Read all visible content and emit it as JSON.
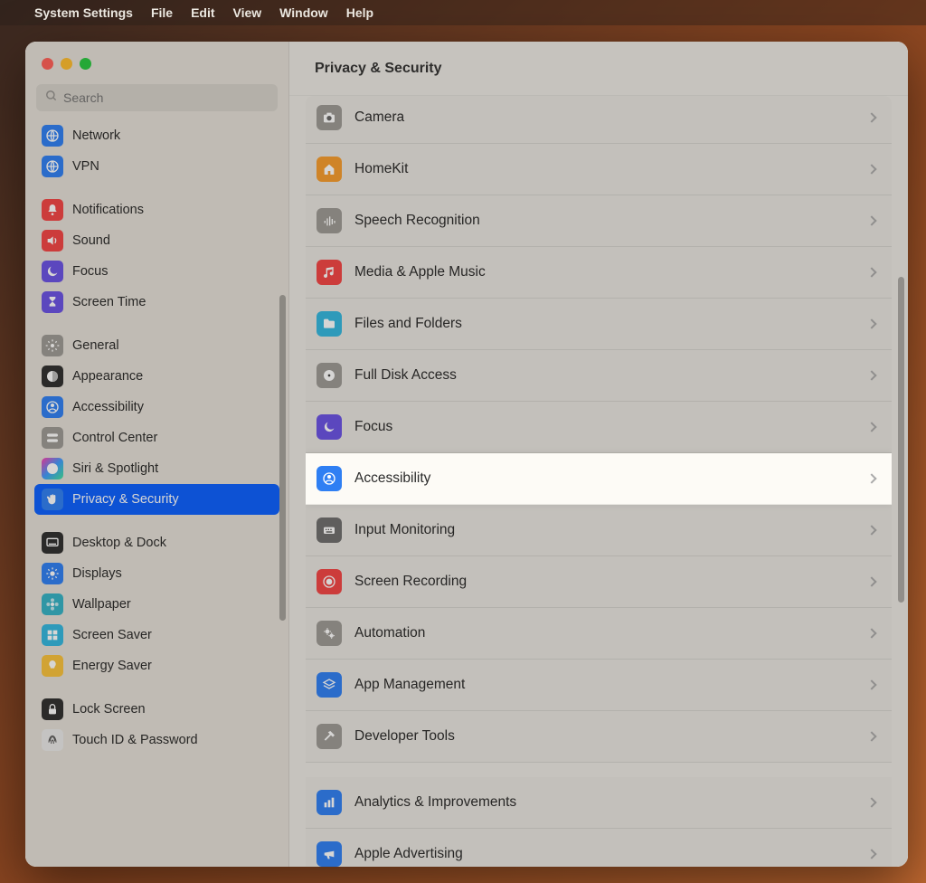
{
  "menubar": {
    "apple": "",
    "app": "System Settings",
    "items": [
      "File",
      "Edit",
      "View",
      "Window",
      "Help"
    ]
  },
  "search_placeholder": "Search",
  "page_title": "Privacy & Security",
  "sidebar_groups": [
    {
      "items": [
        {
          "label": "Network",
          "icon": "globe",
          "bg": "bg-blue"
        },
        {
          "label": "VPN",
          "icon": "globe",
          "bg": "bg-blue"
        }
      ]
    },
    {
      "items": [
        {
          "label": "Notifications",
          "icon": "bell",
          "bg": "bg-red"
        },
        {
          "label": "Sound",
          "icon": "speaker",
          "bg": "bg-red"
        },
        {
          "label": "Focus",
          "icon": "moon",
          "bg": "bg-purple"
        },
        {
          "label": "Screen Time",
          "icon": "hourglass",
          "bg": "bg-purple"
        }
      ]
    },
    {
      "items": [
        {
          "label": "General",
          "icon": "gear",
          "bg": "bg-gray"
        },
        {
          "label": "Appearance",
          "icon": "contrast",
          "bg": "bg-black"
        },
        {
          "label": "Accessibility",
          "icon": "person",
          "bg": "bg-blue"
        },
        {
          "label": "Control Center",
          "icon": "switches",
          "bg": "bg-gray"
        },
        {
          "label": "Siri & Spotlight",
          "icon": "siri",
          "bg": "bg-siri"
        },
        {
          "label": "Privacy & Security",
          "icon": "hand",
          "bg": "bg-blue",
          "selected": true
        }
      ]
    },
    {
      "items": [
        {
          "label": "Desktop & Dock",
          "icon": "dock",
          "bg": "bg-black"
        },
        {
          "label": "Displays",
          "icon": "sun",
          "bg": "bg-blue"
        },
        {
          "label": "Wallpaper",
          "icon": "flower",
          "bg": "bg-teal"
        },
        {
          "label": "Screen Saver",
          "icon": "squares",
          "bg": "bg-cyan"
        },
        {
          "label": "Energy Saver",
          "icon": "bulb",
          "bg": "bg-yellow"
        }
      ]
    },
    {
      "items": [
        {
          "label": "Lock Screen",
          "icon": "lock",
          "bg": "bg-black"
        },
        {
          "label": "Touch ID & Password",
          "icon": "finger",
          "bg": "bg-white"
        }
      ]
    }
  ],
  "rows": [
    {
      "label": "Camera",
      "icon": "camera",
      "bg": "bg-gray"
    },
    {
      "label": "HomeKit",
      "icon": "house",
      "bg": "bg-orange"
    },
    {
      "label": "Speech Recognition",
      "icon": "wave",
      "bg": "bg-gray"
    },
    {
      "label": "Media & Apple Music",
      "icon": "music",
      "bg": "bg-red"
    },
    {
      "label": "Files and Folders",
      "icon": "folder",
      "bg": "bg-cyan"
    },
    {
      "label": "Full Disk Access",
      "icon": "disk",
      "bg": "bg-gray"
    },
    {
      "label": "Focus",
      "icon": "moon",
      "bg": "bg-purple"
    },
    {
      "label": "Accessibility",
      "icon": "person",
      "bg": "bg-blue",
      "highlight": true
    },
    {
      "label": "Input Monitoring",
      "icon": "keyboard",
      "bg": "bg-darkgray"
    },
    {
      "label": "Screen Recording",
      "icon": "rec",
      "bg": "bg-red"
    },
    {
      "label": "Automation",
      "icon": "gears",
      "bg": "bg-gray"
    },
    {
      "label": "App Management",
      "icon": "app",
      "bg": "bg-blue"
    },
    {
      "label": "Developer Tools",
      "icon": "hammer",
      "bg": "bg-gray"
    },
    {
      "label": "Analytics & Improvements",
      "icon": "chart",
      "bg": "bg-blue",
      "newSection": true
    },
    {
      "label": "Apple Advertising",
      "icon": "mega",
      "bg": "bg-blue"
    }
  ]
}
